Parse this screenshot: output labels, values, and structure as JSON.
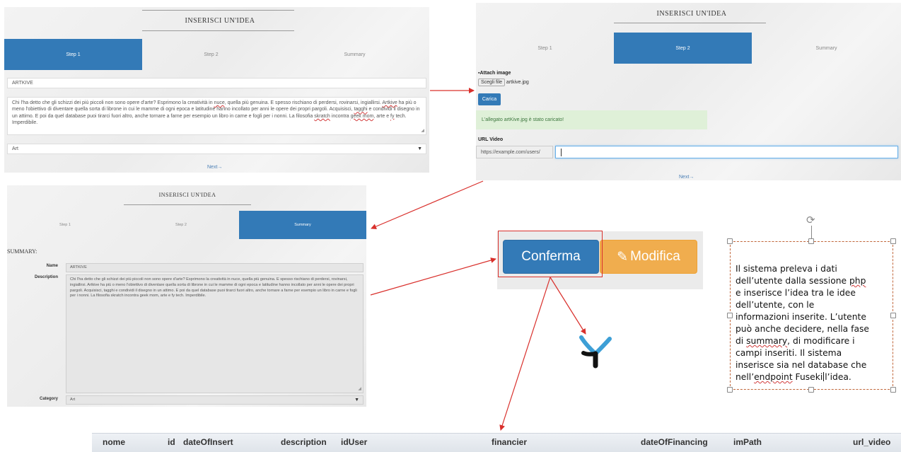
{
  "panel1": {
    "title": "INSERISCI UN'IDEA",
    "steps": [
      "Step 1",
      "Step 2",
      "Summary"
    ],
    "name_value": "ARTKIVE",
    "description": {
      "part1": "Chi l'ha detto che gli schizzi dei più piccoli non sono opere d'arte? Esprimono la creatività in ",
      "nuce": "nuce",
      "part2": ", quella più genuina. E spesso rischiano di perdersi, rovinarsi, ingiallirsi. ",
      "artkive": "Artkive",
      "part3": " ha più o meno l'obiettivo di diventare quella sorta di librone in cui le mamme di ogni epoca e latitudine hanno incollato per anni le opere dei propri pargoli. Acquisisci, ",
      "tagghi": "tagghi",
      "part4": " e condividi il disegno in un attimo. E poi da quel database puoi tirarci fuori altro, anche tornare a farne per esempio un libro in carne e fogli per i nonni. La filosofia ",
      "skratch": "skratch",
      "part5": " incontra ",
      "geek": "geek mom",
      "part6": ", arte e ",
      "fy": "fy",
      "part7": " tech. Imperdibile."
    },
    "category": "Art",
    "next": "Next→"
  },
  "panel2": {
    "title": "INSERISCI UN'IDEA",
    "steps": [
      "Step 1",
      "Step 2",
      "Summary"
    ],
    "attach_label": "Attach image",
    "choose_file": "Scegli file",
    "file_name": "artkive.jpg",
    "upload": "Carica",
    "alert": "L'allegato artKive.jpg è stato caricato!",
    "url_label": "URL Video",
    "url_prefix": "https://example.com/users/",
    "next": "Next→"
  },
  "panel3": {
    "title": "INSERISCI UN'IDEA",
    "steps": [
      "Step 1",
      "Step 2",
      "Summary"
    ],
    "summary_heading": "SUMMARY:",
    "name_label": "Name",
    "name_value": "ARTKIVE",
    "description_label": "Description",
    "description_text": "Chi l'ha detto che gli schizzi dei più piccoli non sono opere d'arte? Esprimono la creatività in nuce, quella più genuina. E spesso rischiano di perdersi, rovinarsi, ingiallirsi. Artkive ha più o meno l'obiettivo di diventare quella sorta di librone in cui le mamme di ogni epoca e latitudine hanno incollato per anni le opere dei propri pargoli. Acquisisci, tagghi e condividi il disegno in un attimo. E poi da quel database puoi tirarci fuori altro, anche tornare a farne per esempio un libro in carne e fogli per i nonni. La filosofia skratch incontra geek mom, arte e fy tech. Imperdibile.",
    "category_label": "Category",
    "category_value": "Art"
  },
  "actions": {
    "confirm": "Conferma",
    "edit": "Modifica"
  },
  "note": {
    "lines": [
      "Il sistema preleva i dati",
      "dell’utente dalla sessione ",
      "e inserisce l’idea tra le idee",
      "dell’utente, con le",
      "informazioni inserite. L’utente",
      "può anche decidere, nella fase",
      "di ",
      "campi inseriti. Il sistema",
      "inserisce sia nel database che",
      "nell’"
    ],
    "php": "php",
    "summary_word": "summary",
    "line7_rest": ", di modificare i",
    "endpoint": "endpoint",
    "fuseki": " Fuseki",
    "line10_rest": "l’idea."
  },
  "table_columns": [
    "nome",
    "id",
    "dateOfInsert",
    "description",
    "idUser",
    "financier",
    "dateOfFinancing",
    "imPath",
    "url_video"
  ],
  "colors": {
    "primary": "#337ab7",
    "warning": "#f0ad4e",
    "success_bg": "#dff0d8",
    "arrow": "#d9302c"
  }
}
